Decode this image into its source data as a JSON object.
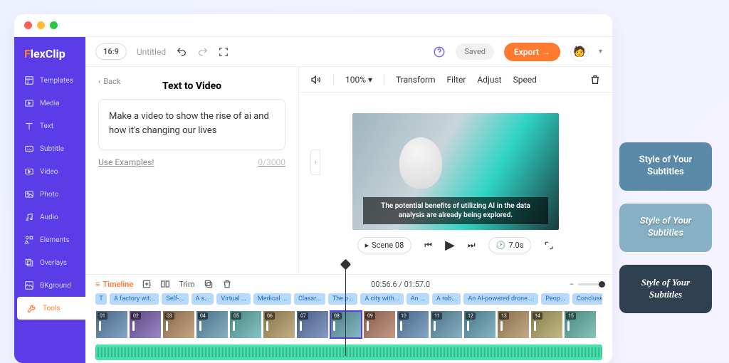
{
  "logo_part1": "F",
  "logo_part2": "lexClip",
  "sidebar": [
    {
      "label": "Templates"
    },
    {
      "label": "Media"
    },
    {
      "label": "Text"
    },
    {
      "label": "Subtitle"
    },
    {
      "label": "Video"
    },
    {
      "label": "Photo"
    },
    {
      "label": "Audio"
    },
    {
      "label": "Elements"
    },
    {
      "label": "Overlays"
    },
    {
      "label": "BKground"
    },
    {
      "label": "Tools"
    }
  ],
  "topbar": {
    "ratio": "16:9",
    "title": "Untitled",
    "saved": "Saved",
    "export": "Export"
  },
  "panel": {
    "back": "Back",
    "title": "Text to Video",
    "prompt": "Make a video to show the rise of ai and how it's changing our lives",
    "examples": "Use Examples!",
    "counter": "0/3000"
  },
  "preview": {
    "zoom": "100%",
    "transform": "Transform",
    "filter": "Filter",
    "adjust": "Adjust",
    "speed": "Speed",
    "caption": "The potential benefits of utilizing AI in the data analysis are already being explored.",
    "scene": "Scene 08",
    "duration": "7.0s"
  },
  "timeline": {
    "label": "Timeline",
    "trim": "Trim",
    "time": "00:56.6 / 01:57.0",
    "clips": [
      "T",
      "A factory wit...",
      "Self-...",
      "A s...",
      "Virtual ...",
      "Medical ...",
      "Classr...",
      "The p...",
      "A city with...",
      "An ...",
      "A rob...",
      "An AI-powered drone ...",
      "Peop...",
      "Conclusio..."
    ],
    "thumbs": [
      "01",
      "02",
      "03",
      "04",
      "05",
      "06",
      "07",
      "08",
      "09",
      "10",
      "11",
      "12",
      "13",
      "14",
      "15"
    ]
  },
  "styleCards": [
    "Style of Your Subtitles",
    "Style of Your Subtitles",
    "Style of Your Subtitles"
  ]
}
